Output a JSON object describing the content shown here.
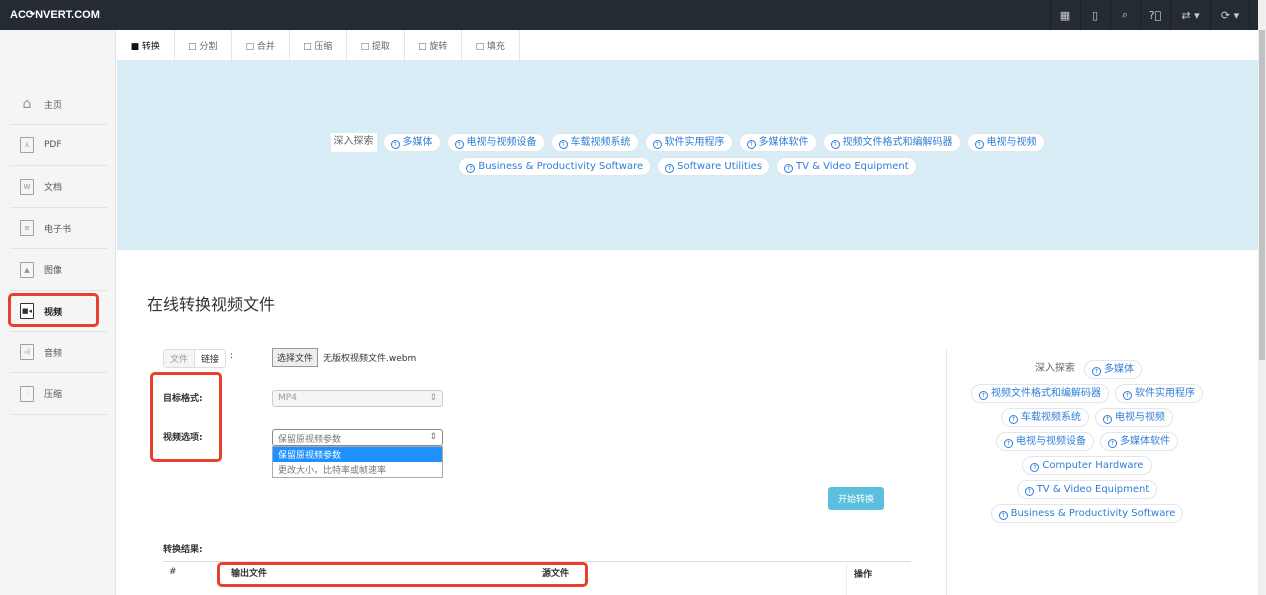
{
  "header": {
    "logo": "AC⟳NVERT.COM",
    "icons": [
      "grid-icon",
      "tablet-icon",
      "search-icon",
      "help-icon",
      "language-icon",
      "refresh-icon"
    ]
  },
  "sidebar": {
    "items": [
      {
        "label": "主页",
        "icon": "home-icon"
      },
      {
        "label": "PDF",
        "icon": "pdf-file-icon"
      },
      {
        "label": "文档",
        "icon": "word-file-icon"
      },
      {
        "label": "电子书",
        "icon": "ebook-file-icon"
      },
      {
        "label": "图像",
        "icon": "image-file-icon"
      },
      {
        "label": "视频",
        "icon": "video-file-icon"
      },
      {
        "label": "音频",
        "icon": "audio-file-icon"
      },
      {
        "label": "压缩",
        "icon": "archive-file-icon"
      }
    ]
  },
  "tabs": [
    "■ 转换",
    "□ 分割",
    "□ 合并",
    "□ 压缩",
    "□ 提取",
    "□ 旋转",
    "□ 填充"
  ],
  "banner": {
    "explore": "深入探索",
    "row1": [
      "多媒体",
      "电视与视频设备",
      "车载视频系统",
      "软件实用程序",
      "多媒体软件",
      "视频文件格式和编解码器",
      "电视与视频"
    ],
    "row2": [
      "Business & Productivity Software",
      "Software Utilities",
      "TV & Video Equipment"
    ]
  },
  "main": {
    "title": "在线转换视频文件",
    "source_tabs": [
      "文件",
      "链接"
    ],
    "colon": ":",
    "choose_file": "选择文件",
    "file_name": "无版权视频文件.webm",
    "target_label": "目标格式:",
    "target_value": "MP4",
    "options_label": "视频选项:",
    "options_value": "保留原视频参数",
    "options_list": [
      "保留原视频参数",
      "更改大小，比特率或帧速率"
    ],
    "start_button": "开始转换",
    "results_label": "转换结果:",
    "table_headers": [
      "#",
      "输出文件",
      "源文件",
      "操作"
    ]
  },
  "right": {
    "explore": "深入探索",
    "tags": [
      [
        "多媒体"
      ],
      [
        "视频文件格式和编解码器",
        "软件实用程序"
      ],
      [
        "车载视频系统",
        "电视与视频"
      ],
      [
        "电视与视频设备",
        "多媒体软件"
      ],
      [
        "Computer Hardware"
      ],
      [
        "TV & Video Equipment"
      ],
      [
        "Business & Productivity Software"
      ]
    ]
  }
}
